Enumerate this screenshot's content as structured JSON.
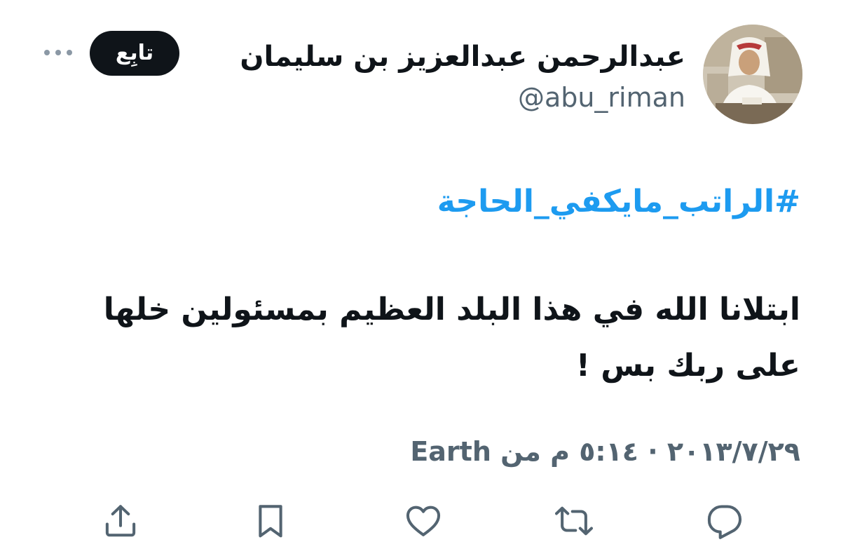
{
  "author": {
    "display_name": "عبدالرحمن عبدالعزيز بن سليمان",
    "handle": "@abu_riman"
  },
  "follow_button": {
    "label": "تابِع"
  },
  "tweet": {
    "hashtag": "#الراتب_مايكفي_الحاجة",
    "text": "ابتلانا الله في هذا البلد العظيم بمسئولين خلها على ربك بس !"
  },
  "meta": {
    "date": "٢٠١٣/٧/٢٩",
    "separator": "·",
    "time": "٥:١٤ م",
    "source_prefix": "من",
    "source": "Earth"
  },
  "icons": {
    "more": "more-dots-icon",
    "reply": "reply-icon",
    "retweet": "retweet-icon",
    "like": "heart-icon",
    "bookmark": "bookmark-icon",
    "share": "share-icon"
  },
  "colors": {
    "accent": "#1d9bf0",
    "text": "#0f1419",
    "secondary": "#536471",
    "button_bg": "#0f1419"
  }
}
